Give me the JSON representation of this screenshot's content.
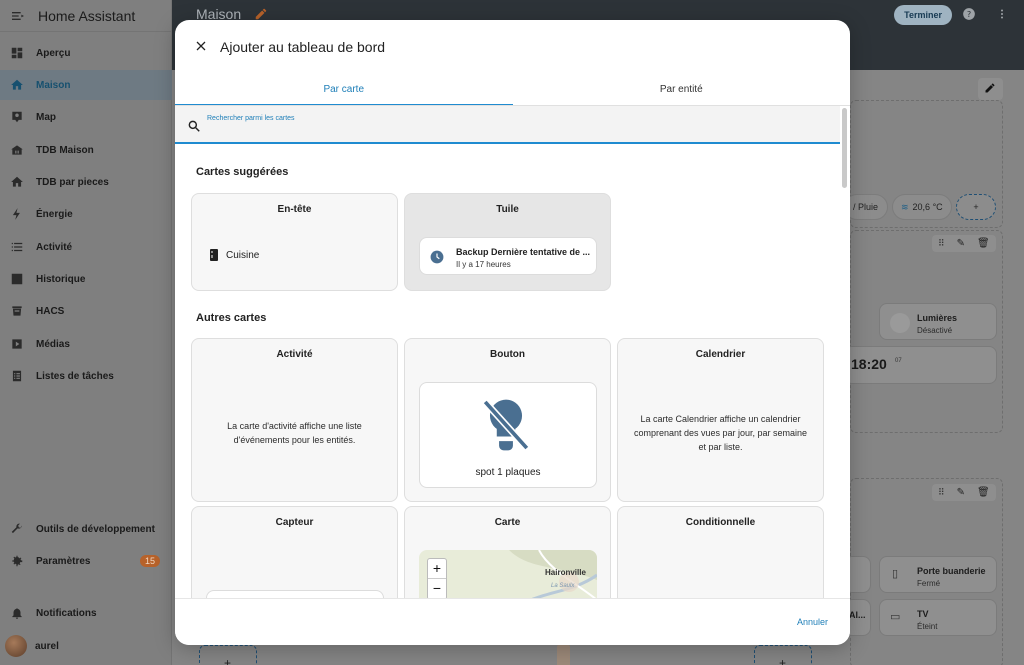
{
  "app": {
    "title": "Home Assistant"
  },
  "sidebar": {
    "items": [
      {
        "label": "Aperçu",
        "icon": "dashboard-icon"
      },
      {
        "label": "Maison",
        "icon": "home-icon",
        "active": true
      },
      {
        "label": "Map",
        "icon": "map-icon"
      },
      {
        "label": "TDB Maison",
        "icon": "home-city-icon"
      },
      {
        "label": "TDB par pieces",
        "icon": "home-icon"
      },
      {
        "label": "Énergie",
        "icon": "lightning-icon"
      },
      {
        "label": "Activité",
        "icon": "list-icon"
      },
      {
        "label": "Historique",
        "icon": "chart-icon"
      },
      {
        "label": "HACS",
        "icon": "hacs-icon"
      },
      {
        "label": "Médias",
        "icon": "media-icon"
      },
      {
        "label": "Listes de tâches",
        "icon": "checklist-icon"
      }
    ],
    "dev_tools": "Outils de développement",
    "settings": "Paramètres",
    "settings_badge": "15",
    "notifications": "Notifications",
    "user": "aurel"
  },
  "topbar": {
    "title": "Maison",
    "done_button": "Terminer"
  },
  "background": {
    "chip_rain": "/ Pluie",
    "chip_temp": "20,6 °C",
    "lights_title": "Lumières",
    "lights_state": "Désactivé",
    "clock": "18:20",
    "clock_seconds": "07",
    "laundry_title": "Porte buanderie",
    "laundry_state": "Fermé",
    "tv_title": "TV",
    "tv_state": "Éteint",
    "truncated_left": "Al..."
  },
  "dialog": {
    "title": "Ajouter au tableau de bord",
    "tabs": [
      "Par carte",
      "Par entité"
    ],
    "search_label": "Rechercher parmi les cartes",
    "suggested_title": "Cartes suggérées",
    "suggested": {
      "header_card": {
        "title": "En-tête",
        "entity": "Cuisine"
      },
      "tile_card": {
        "title": "Tuile",
        "name": "Backup Dernière tentative de ...",
        "state": "Il y a 17 heures"
      }
    },
    "other_title": "Autres cartes",
    "cards": {
      "activity": {
        "title": "Activité",
        "desc": "La carte d'activité affiche une liste d'événements pour les entités."
      },
      "button": {
        "title": "Bouton",
        "entity": "spot 1 plaques"
      },
      "calendar": {
        "title": "Calendrier",
        "desc": "La carte Calendrier affiche un calendrier comprenant des vues par jour, par semaine et par liste."
      },
      "sensor": {
        "title": "Capteur"
      },
      "map": {
        "title": "Carte",
        "place": "Haironville",
        "road": "La Saulx"
      },
      "conditional": {
        "title": "Conditionnelle"
      }
    },
    "cancel": "Annuler"
  },
  "colors": {
    "accent": "#1f8bd0",
    "badge": "#b7622a",
    "icon_blue": "#4a6f91"
  }
}
